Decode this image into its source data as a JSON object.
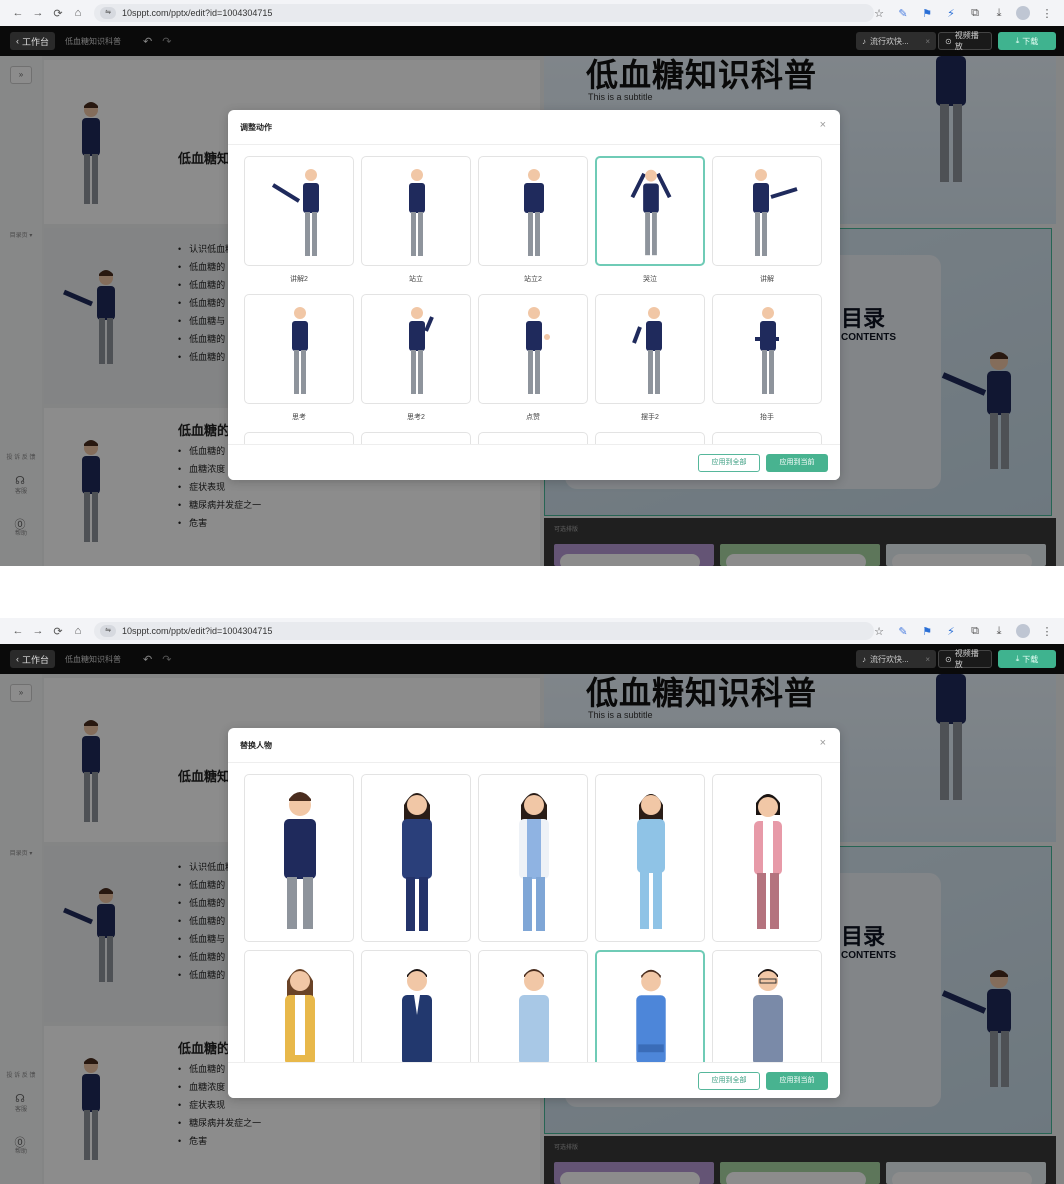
{
  "browser": {
    "url": "10sppt.com/pptx/edit?id=1004304715",
    "nav": [
      "←",
      "→",
      "C",
      "⌂"
    ]
  },
  "header": {
    "back_label": "工作台",
    "doc_title": "低血糖知识科普",
    "music_label": "流行欢快...",
    "video_label": "视频播放",
    "download_label": "下载"
  },
  "sidebar": {
    "expand": "»",
    "slide_label": "目录页 ▾",
    "feedback_label": "投 诉\n反 馈",
    "service_label": "客服",
    "help_label": "帮助"
  },
  "slides": {
    "slide1_title": "低血糖知识科普",
    "slide2_bullets": [
      "认识低血糖",
      "低血糖的",
      "低血糖的",
      "低血糖的",
      "低血糖与",
      "低血糖的",
      "低血糖的"
    ],
    "slide3_title": "低血糖的",
    "slide3_bullets": [
      "低血糖的",
      "血糖浓度",
      "症状表现",
      "糖尿病并发症之一",
      "危害"
    ]
  },
  "preview": {
    "big_title": "低血糖知识科普",
    "subtitle": "This is a subtitle",
    "mulu": "目录",
    "contents": "CONTENTS",
    "bottom_label": "可选排版"
  },
  "modal1": {
    "title": "调整动作",
    "close": "×",
    "row1_labels": [
      "讲解2",
      "站立",
      "站立2",
      "哭泣",
      "讲解"
    ],
    "row2_labels": [
      "思考",
      "思考2",
      "点赞",
      "摆手2",
      "抬手"
    ],
    "apply_all": "应用到全部",
    "apply_current": "应用到当前"
  },
  "modal2": {
    "title": "替换人物",
    "close": "×",
    "apply_all": "应用到全部",
    "apply_current": "应用到当前"
  },
  "colors": {
    "accent": "#48b390",
    "navy_shirt": "#1f2a5c",
    "grey_pants": "#8e949c"
  }
}
